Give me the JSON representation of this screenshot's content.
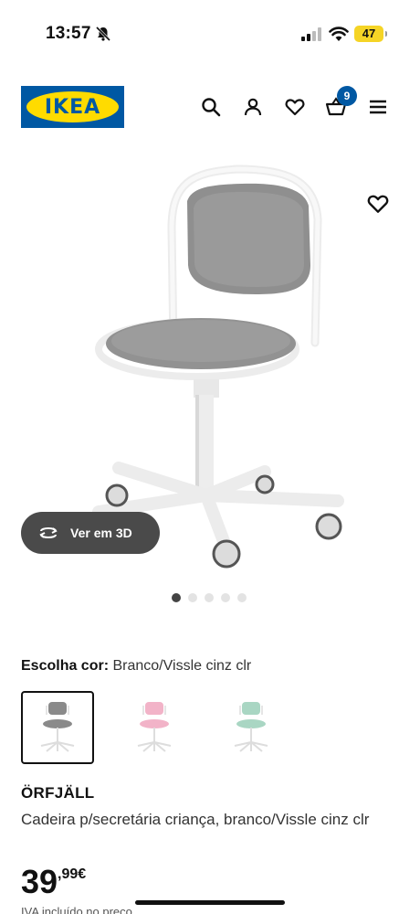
{
  "status_bar": {
    "time": "13:57",
    "battery": "47"
  },
  "header": {
    "logo_text": "IKEA",
    "cart_count": "9",
    "icons": [
      "search-icon",
      "user-icon",
      "heart-icon",
      "cart-icon",
      "menu-icon"
    ]
  },
  "gallery": {
    "view_3d_label": "Ver em 3D",
    "image_count": 5,
    "active_index": 0
  },
  "color_selection": {
    "label": "Escolha cor:",
    "value": "Branco/Vissle cinz clr",
    "options": [
      {
        "name": "grey",
        "seat_color": "#8a8a8a",
        "selected": true
      },
      {
        "name": "pink",
        "seat_color": "#f2b3c8",
        "selected": false
      },
      {
        "name": "green",
        "seat_color": "#a9d6c3",
        "selected": false
      }
    ]
  },
  "product": {
    "name": "ÖRFJÄLL",
    "description": "Cadeira p/secretária criança, branco/Vissle cinz clr",
    "price_integer": "39",
    "price_decimal": ",99€",
    "vat_note": "IVA incluído no preço"
  },
  "colors": {
    "ikea_blue": "#0058a3",
    "ikea_yellow": "#ffdb00",
    "view3d_bg": "#4a4a4a"
  }
}
